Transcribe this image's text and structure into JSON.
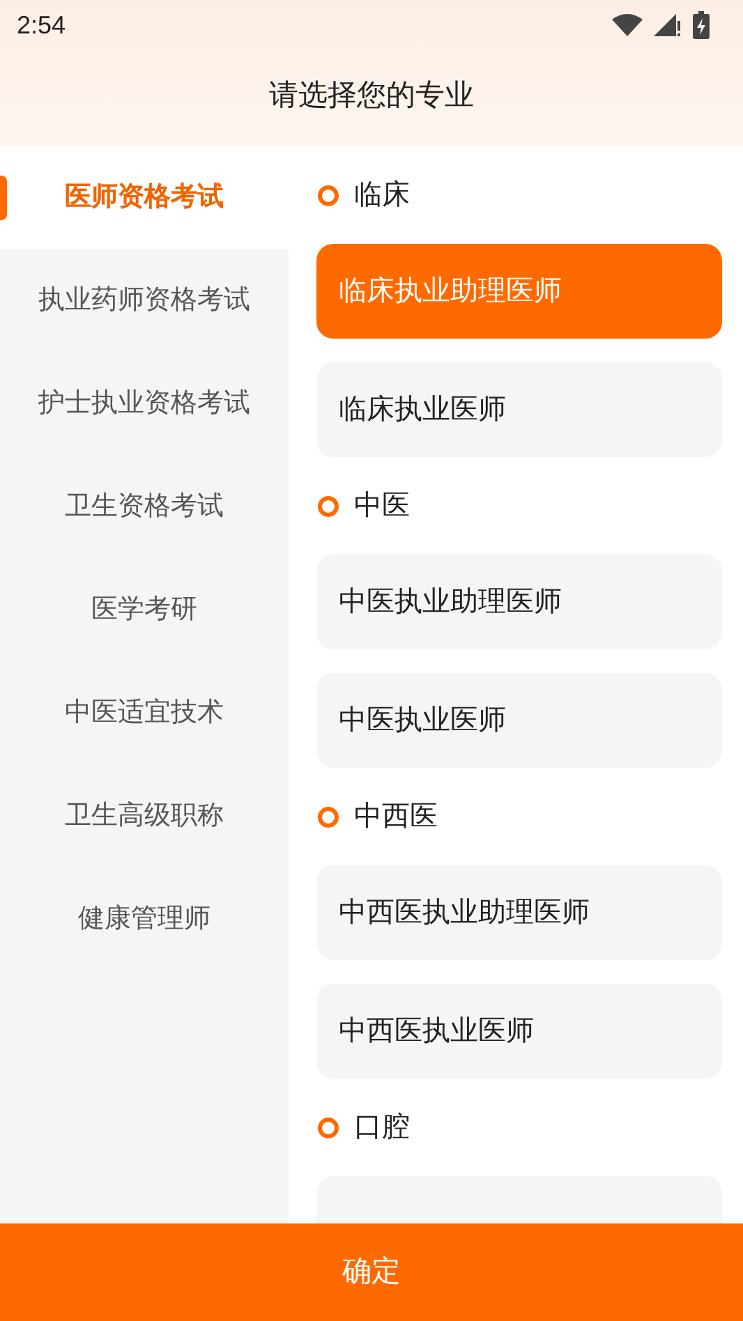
{
  "status_bar": {
    "time": "2:54"
  },
  "header": {
    "title": "请选择您的专业"
  },
  "sidebar": {
    "items": [
      {
        "label": "医师资格考试",
        "selected": true
      },
      {
        "label": "执业药师资格考试",
        "selected": false
      },
      {
        "label": "护士执业资格考试",
        "selected": false
      },
      {
        "label": "卫生资格考试",
        "selected": false
      },
      {
        "label": "医学考研",
        "selected": false
      },
      {
        "label": "中医适宜技术",
        "selected": false
      },
      {
        "label": "卫生高级职称",
        "selected": false
      },
      {
        "label": "健康管理师",
        "selected": false
      }
    ]
  },
  "groups": [
    {
      "title": "临床",
      "options": [
        {
          "label": "临床执业助理医师",
          "selected": true
        },
        {
          "label": "临床执业医师",
          "selected": false
        }
      ]
    },
    {
      "title": "中医",
      "options": [
        {
          "label": "中医执业助理医师",
          "selected": false
        },
        {
          "label": "中医执业医师",
          "selected": false
        }
      ]
    },
    {
      "title": "中西医",
      "options": [
        {
          "label": "中西医执业助理医师",
          "selected": false
        },
        {
          "label": "中西医执业医师",
          "selected": false
        }
      ]
    },
    {
      "title": "口腔",
      "cut_off_card": true
    }
  ],
  "confirm_button": {
    "label": "确定"
  }
}
